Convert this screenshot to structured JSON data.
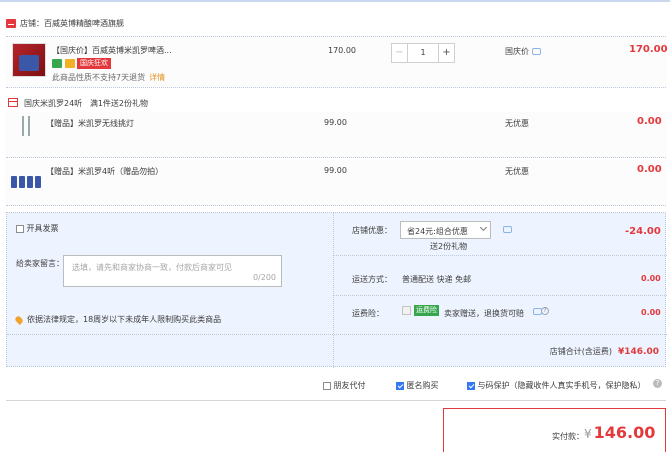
{
  "shop": {
    "label": "店铺：",
    "name": "百威英博精酿啤酒旗舰"
  },
  "item": {
    "title": "【国庆价】百威英博米凯罗啤酒...",
    "badge": "国庆狂欢",
    "notice": "此商品性质不支持7天退货",
    "detail_link": "详情",
    "unit_price": "170.00",
    "quantity": "1",
    "minus": "−",
    "plus": "+",
    "promo": "国庆价",
    "total": "170.00"
  },
  "gift_promo": {
    "title": "国庆米凯罗24听",
    "desc": "满1件送2份礼物"
  },
  "gifts": [
    {
      "title": "【赠品】米凯罗无线挑灯",
      "price": "99.00",
      "promo": "无优惠",
      "total": "0.00"
    },
    {
      "title": "【赠品】米凯罗4听（赠品勿拍）",
      "price": "99.00",
      "promo": "无优惠",
      "total": "0.00"
    }
  ],
  "invoice": {
    "label": "开具发票"
  },
  "message": {
    "label": "给卖家留言：",
    "placeholder": "选填，请先和商家协商一致，付款后商家可见",
    "counter": "0/200"
  },
  "law_notice": "依据法律规定，18周岁以下未成年人限制购买此类商品",
  "coupon": {
    "label": "店铺优惠：",
    "selected": "省24元:组合优惠",
    "sub": "送2份礼物",
    "value": "-24.00"
  },
  "shipping": {
    "label": "运送方式：",
    "value": "普通配送 快递 免邮",
    "fee": "0.00"
  },
  "insurance": {
    "label": "运费险：",
    "badge": "运费险",
    "text": "卖家赠送，退换货可赔",
    "fee": "0.00",
    "help": "?"
  },
  "store_total": {
    "label": "店铺合计(含运费)",
    "value": "¥146.00"
  },
  "options": {
    "friend_pay": "朋友代付",
    "anonymous": "匿名购买",
    "privacy": "与码保护（隐藏收件人真实手机号，保护隐私）"
  },
  "payment": {
    "label": "实付款：",
    "currency": "¥",
    "amount": "146.00"
  },
  "colors": {
    "accent": "#e4393c",
    "panel": "#eef4ff",
    "checkbox": "#3478f6"
  }
}
